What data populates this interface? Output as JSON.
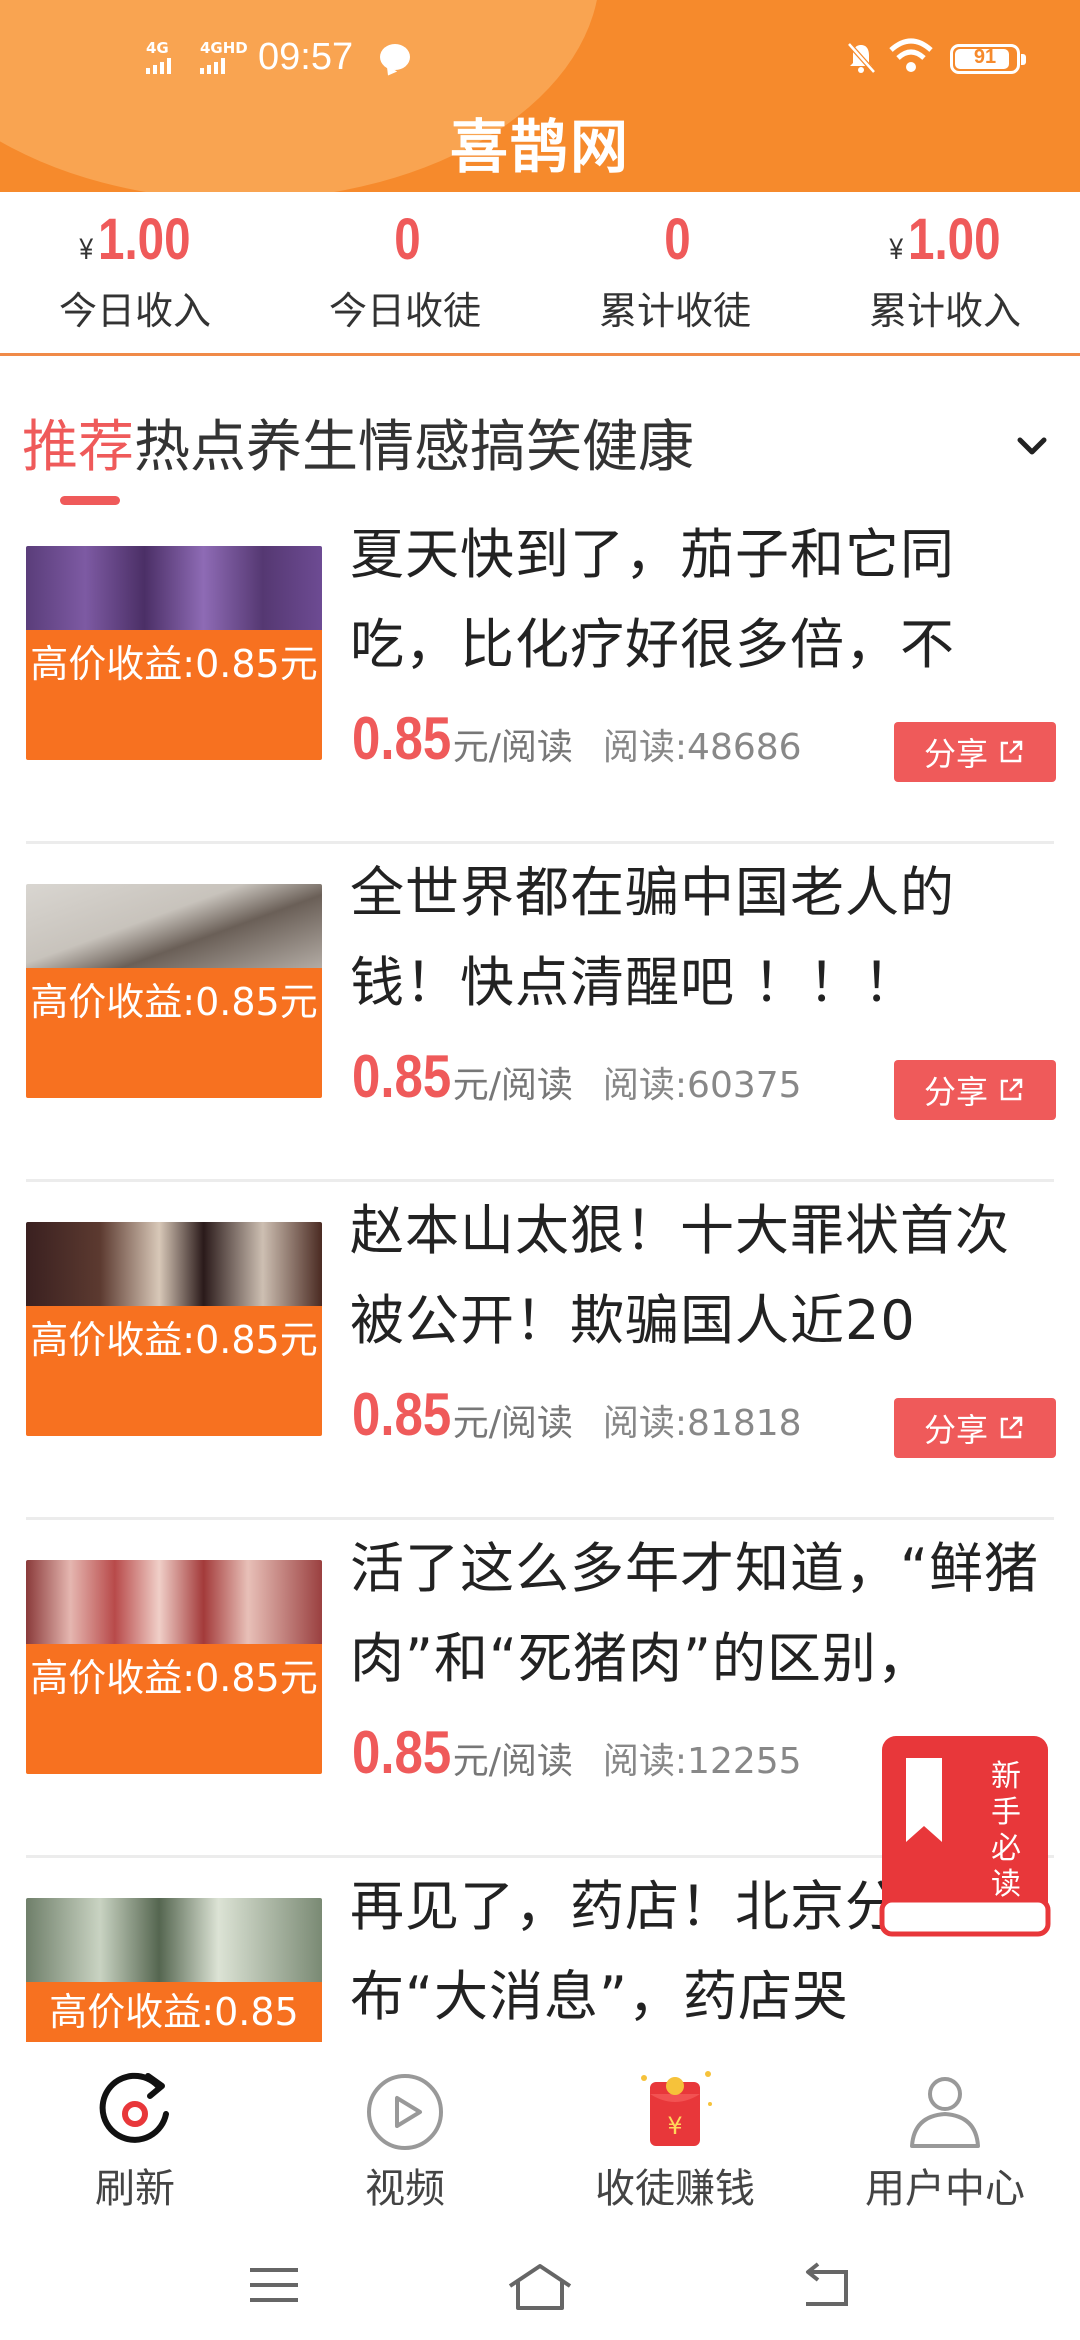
{
  "status_bar": {
    "network1": "4G",
    "network2": "4GHD",
    "time": "09:57",
    "battery": "91",
    "battery_level": 0.91
  },
  "header": {
    "title": "喜鹊网"
  },
  "stats": [
    {
      "currency": "¥",
      "value": "1.00",
      "label": "今日收入"
    },
    {
      "currency": "",
      "value": "0",
      "label": "今日收徒"
    },
    {
      "currency": "",
      "value": "0",
      "label": "累计收徒"
    },
    {
      "currency": "¥",
      "value": "1.00",
      "label": "累计收入"
    }
  ],
  "tabs": [
    "推荐",
    "热点",
    "养生",
    "情感",
    "搞笑",
    "健康"
  ],
  "articles": [
    {
      "title": "夏天快到了，茄子和它同吃，比化疗好很多倍，不",
      "badge": "高价收益:0.85元",
      "price": "0.85",
      "unit": "元/阅读",
      "reads": "阅读:48686",
      "share": "分享"
    },
    {
      "title": "全世界都在骗中国老人的钱！快点清醒吧 ！！！",
      "badge": "高价收益:0.85元",
      "price": "0.85",
      "unit": "元/阅读",
      "reads": "阅读:60375",
      "share": "分享"
    },
    {
      "title": "赵本山太狠！十大罪状首次被公开！欺骗国人近20",
      "badge": "高价收益:0.85元",
      "price": "0.85",
      "unit": "元/阅读",
      "reads": "阅读:81818",
      "share": "分享"
    },
    {
      "title": "活了这么多年才知道，“鲜猪肉”和“死猪肉”的区别，",
      "badge": "高价收益:0.85元",
      "price": "0.85",
      "unit": "元/阅读",
      "reads": "阅读:12255",
      "share": "分享"
    },
    {
      "title": "再见了，药店！北京分宣布“大消息”，药店哭",
      "badge": "高价收益:0.85",
      "price": "",
      "unit": "",
      "reads": "",
      "share": ""
    }
  ],
  "float_guide": {
    "line1": "新",
    "line2": "手",
    "line3": "必",
    "line4": "读"
  },
  "bottom_nav": [
    {
      "label": "刷新",
      "icon": "refresh-icon"
    },
    {
      "label": "视频",
      "icon": "play-icon"
    },
    {
      "label": "收徒赚钱",
      "icon": "red-envelope-icon"
    },
    {
      "label": "用户中心",
      "icon": "user-icon"
    }
  ],
  "colors": {
    "header": "#f68a2c",
    "accent_red": "#ef5a5a",
    "badge_orange": "#f77120"
  }
}
